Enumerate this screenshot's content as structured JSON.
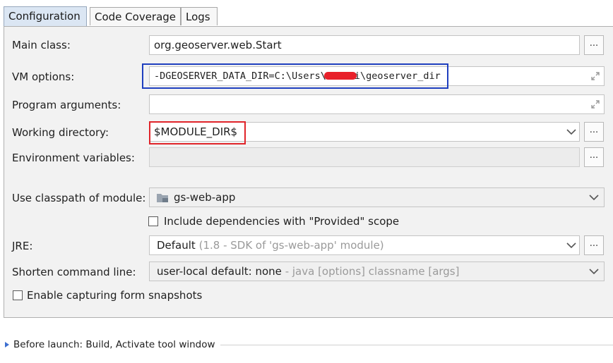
{
  "tabs": [
    {
      "label": "Configuration",
      "active": true
    },
    {
      "label": "Code Coverage",
      "active": false
    },
    {
      "label": "Logs",
      "active": false
    }
  ],
  "main_class": {
    "label": "Main class:",
    "value": "org.geoserver.web.Start",
    "button": "..."
  },
  "vm_options": {
    "label": "VM options:",
    "value_prefix": "-DGEOSERVER_DATA_DIR=C:\\Users\\",
    "value_suffix": "i\\geoserver_dir"
  },
  "program_arguments": {
    "label": "Program arguments:",
    "value": ""
  },
  "working_directory": {
    "label": "Working directory:",
    "value": "$MODULE_DIR$",
    "button": "..."
  },
  "environment_variables": {
    "label": "Environment variables:",
    "value": "",
    "button": "..."
  },
  "classpath_module": {
    "label": "Use classpath of module:",
    "value": "gs-web-app"
  },
  "include_provided": {
    "label": "Include dependencies with \"Provided\" scope",
    "checked": false
  },
  "jre": {
    "label": "JRE:",
    "value": "Default",
    "hint": "(1.8 - SDK of 'gs-web-app' module)",
    "button": "..."
  },
  "shorten_command_line": {
    "label": "Shorten command line:",
    "value": "user-local default: none",
    "hint": "- java [options] classname [args]"
  },
  "form_snapshots": {
    "label": "Enable capturing form snapshots",
    "checked": false
  },
  "before_launch": {
    "label": "Before launch: Build, Activate tool window"
  },
  "colors": {
    "active_tab": "#dbe6f3",
    "panel_bg": "#f2f2f2",
    "blue_highlight": "#1f3fbf",
    "red_highlight": "#e0242a",
    "redaction": "#e8202a"
  }
}
